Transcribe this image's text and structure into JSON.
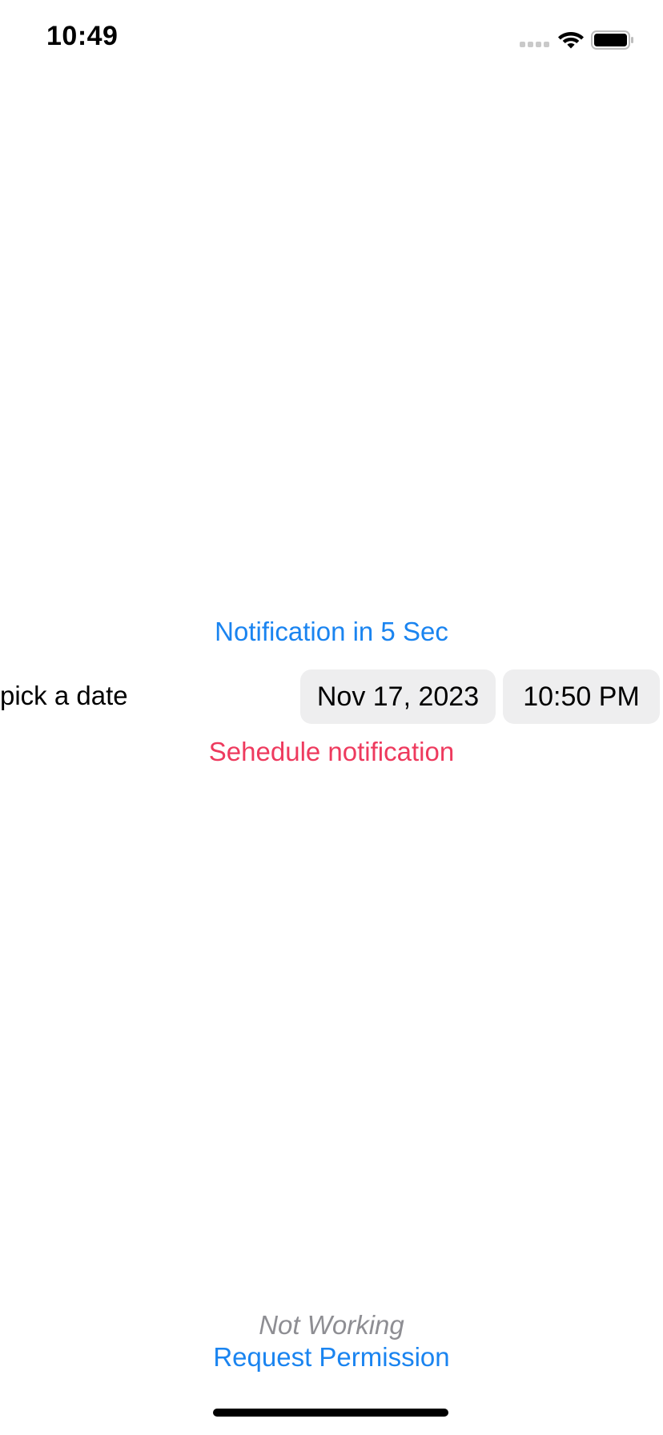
{
  "status_bar": {
    "time": "10:49",
    "icons": [
      "signal-icon",
      "wifi-icon",
      "battery-icon"
    ]
  },
  "main": {
    "notify_5sec_label": "Notification in 5 Sec",
    "pick_date_label": "pick a date",
    "date_value": "Nov 17, 2023",
    "time_value": "10:50 PM",
    "schedule_label": "Sehedule notification"
  },
  "footer": {
    "status_text": "Not Working",
    "request_label": "Request Permission"
  },
  "colors": {
    "accent_blue": "#1a84f0",
    "accent_red": "#ee3a5e",
    "muted_gray": "#8e8e93",
    "pill_bg": "#eeeeef"
  }
}
